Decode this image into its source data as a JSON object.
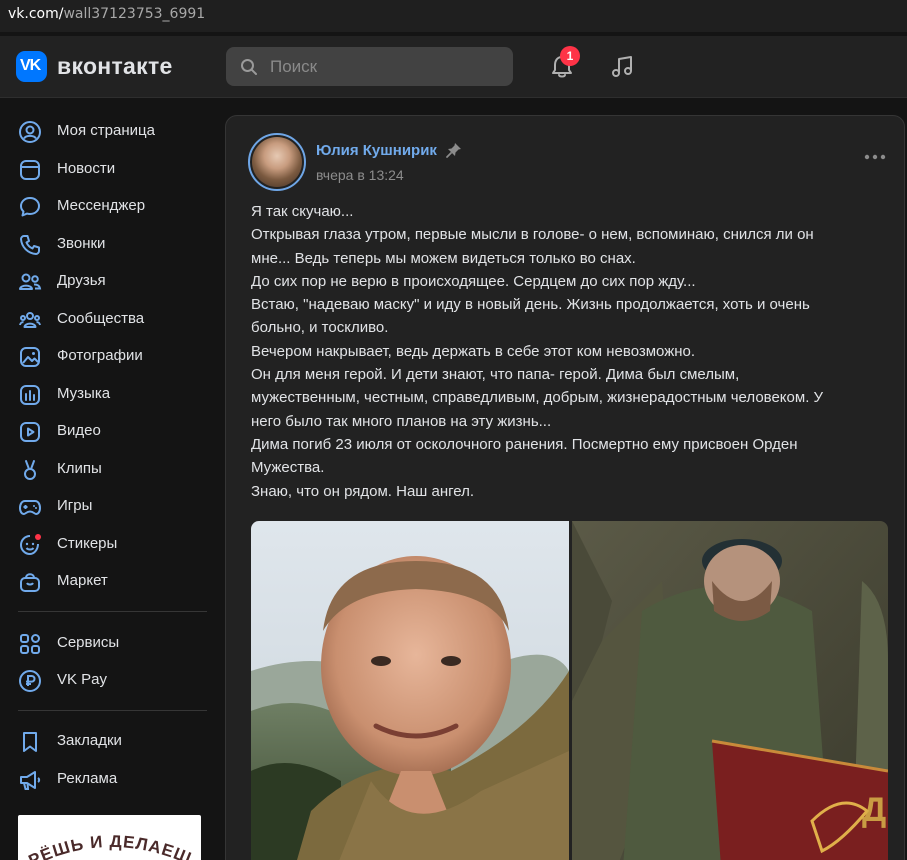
{
  "browser": {
    "url_domain": "vk.com/",
    "url_path": "wall37123753_6991"
  },
  "header": {
    "logo_mark": "VK",
    "logo_text": "вконтакте",
    "search_placeholder": "Поиск",
    "notifications_count": "1",
    "icons": [
      "search-icon",
      "bell-icon",
      "music-note-icon"
    ]
  },
  "sidebar": {
    "items": [
      {
        "label": "Моя страница",
        "icon": "user-circle-icon"
      },
      {
        "label": "Новости",
        "icon": "news-icon"
      },
      {
        "label": "Мессенджер",
        "icon": "chat-bubble-icon"
      },
      {
        "label": "Звонки",
        "icon": "phone-icon"
      },
      {
        "label": "Друзья",
        "icon": "friends-icon"
      },
      {
        "label": "Сообщества",
        "icon": "communities-icon"
      },
      {
        "label": "Фотографии",
        "icon": "photo-icon"
      },
      {
        "label": "Музыка",
        "icon": "music-icon"
      },
      {
        "label": "Видео",
        "icon": "video-icon"
      },
      {
        "label": "Клипы",
        "icon": "clips-icon"
      },
      {
        "label": "Игры",
        "icon": "gamepad-icon"
      },
      {
        "label": "Стикеры",
        "icon": "sticker-icon"
      },
      {
        "label": "Маркет",
        "icon": "market-bag-icon"
      }
    ],
    "items2": [
      {
        "label": "Сервисы",
        "icon": "services-grid-icon"
      },
      {
        "label": "VK Pay",
        "icon": "ruble-icon"
      }
    ],
    "items3": [
      {
        "label": "Закладки",
        "icon": "bookmark-icon"
      },
      {
        "label": "Реклама",
        "icon": "megaphone-icon"
      }
    ],
    "promo_text": "РЁШЬ И ДЕЛАЕШ"
  },
  "post": {
    "author": "Юлия Кушнирик",
    "time": "вчера в 13:24",
    "lines": [
      "Я так скучаю...",
      "Открывая глаза утром, первые мысли в голове- о нем, вспоминаю, снился ли он",
      "мне... Ведь теперь мы можем видеться только во снах.",
      "До сих пор не верю в происходящее. Сердцем до сих пор жду...",
      "Встаю, \"надеваю маску\" и иду в новый день. Жизнь продолжается, хоть и очень",
      "больно, и тоскливо.",
      "Вечером накрывает, ведь держать в себе этот ком невозможно.",
      "Он для меня герой. И дети знают, что папа- герой. Дима был смелым,",
      "мужественным, честным, справедливым, добрым, жизнерадостным человеком. У",
      "него было так много планов на эту жизнь...",
      "Дима погиб 23 июля от осколочного ранения. Посмертно ему присвоен Орден",
      "Мужества.",
      "Знаю, что он рядом. Наш ангел."
    ]
  },
  "colors": {
    "accent": "#0077ff",
    "link": "#71aaeb",
    "badge": "#ff3347",
    "background": "#141414",
    "card": "#222222"
  }
}
